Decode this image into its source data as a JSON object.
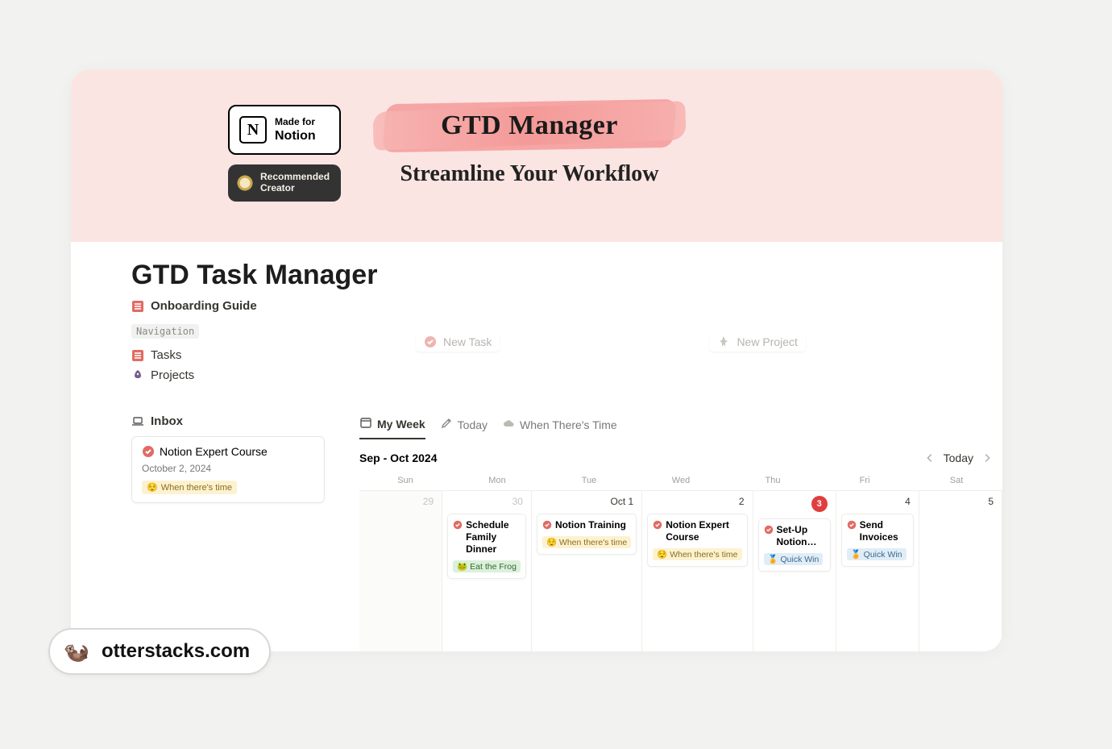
{
  "cover": {
    "made_for_small": "Made for",
    "made_for_strong": "Notion",
    "recommended_line1": "Recommended",
    "recommended_line2": "Creator",
    "title": "GTD Manager",
    "subtitle": "Streamline Your Workflow"
  },
  "page": {
    "title": "GTD Task Manager",
    "onboarding": "Onboarding Guide",
    "nav_label": "Navigation",
    "nav_items": [
      {
        "icon": "list",
        "label": "Tasks"
      },
      {
        "icon": "rocket",
        "label": "Projects"
      }
    ],
    "inbox_label": "Inbox",
    "inbox_card": {
      "title": "Notion Expert Course",
      "date": "October 2, 2024",
      "chip": "When there's time"
    }
  },
  "newbtns": {
    "task": "New Task",
    "project": "New Project"
  },
  "tabs": [
    {
      "icon": "calendar",
      "label": "My Week",
      "active": true
    },
    {
      "icon": "pen",
      "label": "Today",
      "active": false
    },
    {
      "icon": "cloud",
      "label": "When There's Time",
      "active": false
    }
  ],
  "calendar": {
    "range": "Sep - Oct 2024",
    "today_btn": "Today",
    "dow": [
      "Sun",
      "Mon",
      "Tue",
      "Wed",
      "Thu",
      "Fri",
      "Sat"
    ],
    "days": [
      {
        "num": "29",
        "dim": true,
        "events": []
      },
      {
        "num": "30",
        "dim": true,
        "events": [
          {
            "title": "Schedule Family Dinner",
            "chip": "Eat the Frog",
            "chip_style": "green"
          }
        ]
      },
      {
        "num": "Oct 1",
        "events": [
          {
            "title": "Notion Training",
            "chip": "When there's time",
            "chip_style": "yellow"
          }
        ]
      },
      {
        "num": "2",
        "events": [
          {
            "title": "Notion Expert Course",
            "chip": "When there's time",
            "chip_style": "yellow"
          }
        ]
      },
      {
        "num": "3",
        "today": true,
        "events": [
          {
            "title": "Set-Up Notion…",
            "chip": "Quick Win",
            "chip_style": "blue"
          }
        ]
      },
      {
        "num": "4",
        "events": [
          {
            "title": "Send Invoices",
            "chip": "Quick Win",
            "chip_style": "blue"
          }
        ]
      },
      {
        "num": "5",
        "events": []
      }
    ]
  },
  "brand": "otterstacks.com"
}
